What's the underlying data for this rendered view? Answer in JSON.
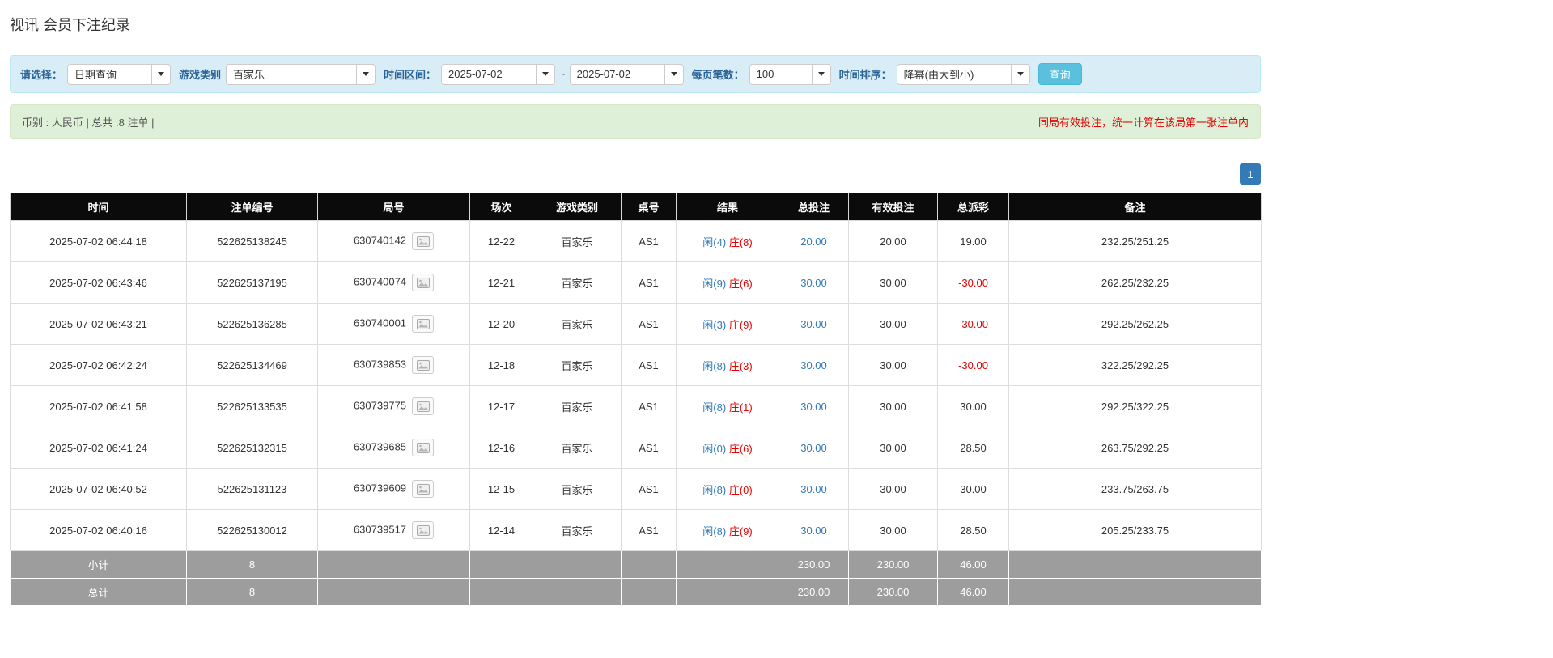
{
  "page": {
    "title": "视讯 会员下注纪录"
  },
  "filters": {
    "query_type": {
      "label": "请选择：",
      "value": "日期查询"
    },
    "game_type": {
      "label": "游戏类别",
      "value": "百家乐"
    },
    "date_range": {
      "label": "时间区间：",
      "from": "2025-07-02",
      "separator": "~",
      "to": "2025-07-02"
    },
    "page_size": {
      "label": "每页笔数：",
      "value": "100"
    },
    "sort": {
      "label": "时间排序：",
      "value": "降幂(由大到小)"
    },
    "search_button_label": "查询"
  },
  "summary": {
    "info": "币别 : 人民币 | 总共 :8 注单 |",
    "warning": "同局有效投注，统一计算在该局第一张注单内"
  },
  "pagination": {
    "current": "1"
  },
  "colors": {
    "accent_blue": "#337ab7",
    "player_blue": "#337ab7",
    "banker_red": "#e60000",
    "negative_red": "#e60000",
    "filter_bar_bg": "#d9edf7",
    "summary_bar_bg": "#dff0d8",
    "table_header_bg": "#0b0b0b",
    "table_footer_bg": "#9d9d9d",
    "search_button_bg": "#5bc0de"
  },
  "table": {
    "headers": [
      "时间",
      "注单编号",
      "局号",
      "场次",
      "游戏类别",
      "桌号",
      "结果",
      "总投注",
      "有效投注",
      "总派彩",
      "备注"
    ],
    "rows": [
      {
        "time": "2025-07-02 06:44:18",
        "bet_no": "522625138245",
        "round_no": "630740142",
        "session": "12-22",
        "game": "百家乐",
        "table_no": "AS1",
        "result_player": "闲(4)",
        "result_banker": "庄(8)",
        "total_bet": "20.00",
        "valid_bet": "20.00",
        "payout": "19.00",
        "note": "232.25/251.25"
      },
      {
        "time": "2025-07-02 06:43:46",
        "bet_no": "522625137195",
        "round_no": "630740074",
        "session": "12-21",
        "game": "百家乐",
        "table_no": "AS1",
        "result_player": "闲(9)",
        "result_banker": "庄(6)",
        "total_bet": "30.00",
        "valid_bet": "30.00",
        "payout": "-30.00",
        "note": "262.25/232.25"
      },
      {
        "time": "2025-07-02 06:43:21",
        "bet_no": "522625136285",
        "round_no": "630740001",
        "session": "12-20",
        "game": "百家乐",
        "table_no": "AS1",
        "result_player": "闲(3)",
        "result_banker": "庄(9)",
        "total_bet": "30.00",
        "valid_bet": "30.00",
        "payout": "-30.00",
        "note": "292.25/262.25"
      },
      {
        "time": "2025-07-02 06:42:24",
        "bet_no": "522625134469",
        "round_no": "630739853",
        "session": "12-18",
        "game": "百家乐",
        "table_no": "AS1",
        "result_player": "闲(8)",
        "result_banker": "庄(3)",
        "total_bet": "30.00",
        "valid_bet": "30.00",
        "payout": "-30.00",
        "note": "322.25/292.25"
      },
      {
        "time": "2025-07-02 06:41:58",
        "bet_no": "522625133535",
        "round_no": "630739775",
        "session": "12-17",
        "game": "百家乐",
        "table_no": "AS1",
        "result_player": "闲(8)",
        "result_banker": "庄(1)",
        "total_bet": "30.00",
        "valid_bet": "30.00",
        "payout": "30.00",
        "note": "292.25/322.25"
      },
      {
        "time": "2025-07-02 06:41:24",
        "bet_no": "522625132315",
        "round_no": "630739685",
        "session": "12-16",
        "game": "百家乐",
        "table_no": "AS1",
        "result_player": "闲(0)",
        "result_banker": "庄(6)",
        "total_bet": "30.00",
        "valid_bet": "30.00",
        "payout": "28.50",
        "note": "263.75/292.25"
      },
      {
        "time": "2025-07-02 06:40:52",
        "bet_no": "522625131123",
        "round_no": "630739609",
        "session": "12-15",
        "game": "百家乐",
        "table_no": "AS1",
        "result_player": "闲(8)",
        "result_banker": "庄(0)",
        "total_bet": "30.00",
        "valid_bet": "30.00",
        "payout": "30.00",
        "note": "233.75/263.75"
      },
      {
        "time": "2025-07-02 06:40:16",
        "bet_no": "522625130012",
        "round_no": "630739517",
        "session": "12-14",
        "game": "百家乐",
        "table_no": "AS1",
        "result_player": "闲(8)",
        "result_banker": "庄(9)",
        "total_bet": "30.00",
        "valid_bet": "30.00",
        "payout": "28.50",
        "note": "205.25/233.75"
      }
    ],
    "footer": [
      {
        "label": "小计",
        "bet_count": "8",
        "total_bet": "230.00",
        "valid_bet": "230.00",
        "payout": "46.00"
      },
      {
        "label": "总计",
        "bet_count": "8",
        "total_bet": "230.00",
        "valid_bet": "230.00",
        "payout": "46.00"
      }
    ]
  }
}
